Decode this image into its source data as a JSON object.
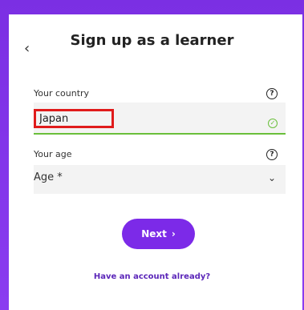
{
  "header": {
    "title": "Sign up as a learner",
    "back_icon": "‹"
  },
  "country": {
    "label": "Your country",
    "value": "Japan",
    "help_icon": "?",
    "valid_icon": "✓"
  },
  "age": {
    "label": "Your age",
    "value": "Age *",
    "help_icon": "?",
    "dropdown_icon": "⌄"
  },
  "actions": {
    "next_label": "Next",
    "next_icon": "›",
    "login_link": "Have an account already?"
  },
  "colors": {
    "accent": "#7c2ae8",
    "valid": "#6abf3b",
    "highlight": "#e01b1b"
  }
}
